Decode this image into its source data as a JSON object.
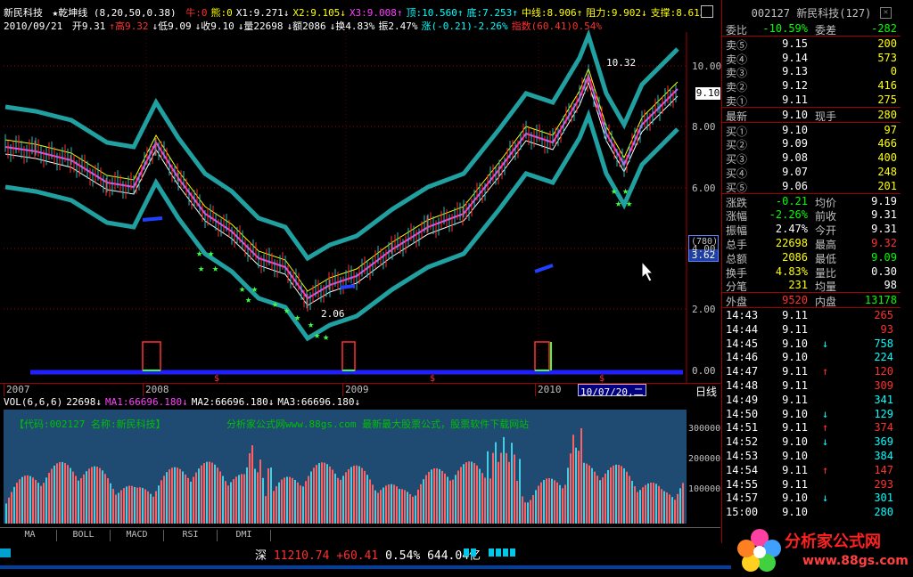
{
  "indicator_bar": {
    "name": "新民科技",
    "formula": "★乾坤线",
    "params": "(8,20,50,0.38)",
    "items": [
      {
        "text": "牛:0",
        "color": "#ff3030"
      },
      {
        "text": "熊:0",
        "color": "#ffff00"
      },
      {
        "text": "X1:9.271↓",
        "color": "#ffffff"
      },
      {
        "text": "X2:9.105↓",
        "color": "#ffff00"
      },
      {
        "text": "X3:9.008↑",
        "color": "#ff40ff"
      },
      {
        "text": "顶:10.560↑",
        "color": "#00ffff"
      },
      {
        "text": "底:7.253↑",
        "color": "#00ffff"
      },
      {
        "text": "中线:8.906↑",
        "color": "#ffff00"
      },
      {
        "text": "阻力:9.902↓",
        "color": "#ffff00"
      },
      {
        "text": "支撑:8.613↓",
        "color": "#ffff00"
      }
    ]
  },
  "ohlc_bar": {
    "date": "2010/09/21",
    "items": [
      {
        "text": "开9.31",
        "color": "#ffffff"
      },
      {
        "text": "↑高9.32",
        "color": "#ff3030"
      },
      {
        "text": "↓低9.09",
        "color": "#ffffff"
      },
      {
        "text": "↓收9.10",
        "color": "#ffffff"
      },
      {
        "text": "↓量22698",
        "color": "#ffffff"
      },
      {
        "text": "↓额2086",
        "color": "#ffffff"
      },
      {
        "text": "↓换4.83%",
        "color": "#ffffff"
      },
      {
        "text": "振2.47%",
        "color": "#ffffff"
      },
      {
        "text": "涨(-0.21)-2.26%",
        "color": "#00ffff"
      },
      {
        "text": "指数(60.41)0.54%",
        "color": "#ff3030"
      }
    ]
  },
  "price_axis": [
    "10.00",
    "8.00",
    "6.00",
    "4.00",
    "2.00",
    "0.00"
  ],
  "price_tag": "9.10",
  "pr_box": {
    "top": "(780)",
    "value": "3.62"
  },
  "chart_annotations": {
    "high": "10.32",
    "low": "2.06"
  },
  "date_axis": {
    "ticks": [
      "2007",
      "2008",
      "2009",
      "2010"
    ],
    "cursor": "10/07/20,二",
    "period": "日线"
  },
  "volume_head": {
    "items": [
      {
        "text": "VOL(6,6,6)",
        "color": "#ffffff"
      },
      {
        "text": "22698↓",
        "color": "#ffffff"
      },
      {
        "text": "MA1:66696.180↓",
        "color": "#ff40ff"
      },
      {
        "text": "MA2:66696.180↓",
        "color": "#ffffff"
      },
      {
        "text": "MA3:66696.180↓",
        "color": "#ffffff"
      }
    ],
    "banner": "【代码:002127 名称:新民科技】",
    "site": "分析家公式网www.88gs.com 最新最大股票公式，股票软件下载网站",
    "axis": [
      "300000",
      "200000",
      "100000"
    ]
  },
  "tabs": [
    "MA",
    "BOLL",
    "MACD",
    "RSI",
    "DMI"
  ],
  "status_bar": {
    "market": "深",
    "index": "11210.74",
    "change": "+60.41",
    "pct": "0.54%",
    "amount": "644.04亿"
  },
  "quote_panel": {
    "code": "002127",
    "name": "新民科技",
    "extra": "(127)",
    "weibi_label": "委比",
    "weibi_value": "-10.59%",
    "weicha_label": "委差",
    "weicha_value": "-282",
    "sell": [
      {
        "label": "卖⑤",
        "price": "9.15",
        "vol": "200"
      },
      {
        "label": "卖④",
        "price": "9.14",
        "vol": "573"
      },
      {
        "label": "卖③",
        "price": "9.13",
        "vol": "0"
      },
      {
        "label": "卖②",
        "price": "9.12",
        "vol": "416"
      },
      {
        "label": "卖①",
        "price": "9.11",
        "vol": "275"
      }
    ],
    "latest": {
      "label": "最新",
      "price": "9.10",
      "label2": "现手",
      "vol": "280"
    },
    "buy": [
      {
        "label": "买①",
        "price": "9.10",
        "vol": "97"
      },
      {
        "label": "买②",
        "price": "9.09",
        "vol": "466"
      },
      {
        "label": "买③",
        "price": "9.08",
        "vol": "400"
      },
      {
        "label": "买④",
        "price": "9.07",
        "vol": "248"
      },
      {
        "label": "买⑤",
        "price": "9.06",
        "vol": "201"
      }
    ],
    "stats": [
      {
        "l1": "涨跌",
        "v1": "-0.21",
        "c1": "#00ff00",
        "l2": "均价",
        "v2": "9.19",
        "c2": "#ffffff"
      },
      {
        "l1": "涨幅",
        "v1": "-2.26%",
        "c1": "#00ff00",
        "l2": "前收",
        "v2": "9.31",
        "c2": "#ffffff"
      },
      {
        "l1": "振幅",
        "v1": "2.47%",
        "c1": "#ffffff",
        "l2": "今开",
        "v2": "9.31",
        "c2": "#ffffff"
      },
      {
        "l1": "总手",
        "v1": "22698",
        "c1": "#ffff00",
        "l2": "最高",
        "v2": "9.32",
        "c2": "#ff3030"
      },
      {
        "l1": "总额",
        "v1": "2086",
        "c1": "#ffff00",
        "l2": "最低",
        "v2": "9.09",
        "c2": "#00ff00"
      },
      {
        "l1": "换手",
        "v1": "4.83%",
        "c1": "#ffff00",
        "l2": "量比",
        "v2": "0.30",
        "c2": "#ffffff"
      },
      {
        "l1": "分笔",
        "v1": "231",
        "c1": "#ffff00",
        "l2": "均量",
        "v2": "98",
        "c2": "#ffffff"
      }
    ],
    "outer": {
      "l1": "外盘",
      "v1": "9520",
      "l2": "内盘",
      "v2": "13178"
    },
    "ticks": [
      {
        "time": "14:43",
        "price": "9.11",
        "arrow": "",
        "vol": "265",
        "vcolor": "#ff3030"
      },
      {
        "time": "14:44",
        "price": "9.11",
        "arrow": "",
        "vol": "93",
        "vcolor": "#ff3030"
      },
      {
        "time": "14:45",
        "price": "9.10",
        "arrow": "↓",
        "vol": "758",
        "vcolor": "#00ffff"
      },
      {
        "time": "14:46",
        "price": "9.10",
        "arrow": "",
        "vol": "224",
        "vcolor": "#00ffff"
      },
      {
        "time": "14:47",
        "price": "9.11",
        "arrow": "↑",
        "vol": "120",
        "vcolor": "#ff3030"
      },
      {
        "time": "14:48",
        "price": "9.11",
        "arrow": "",
        "vol": "309",
        "vcolor": "#ff3030"
      },
      {
        "time": "14:49",
        "price": "9.11",
        "arrow": "",
        "vol": "341",
        "vcolor": "#00ffff"
      },
      {
        "time": "14:50",
        "price": "9.10",
        "arrow": "↓",
        "vol": "129",
        "vcolor": "#00ffff"
      },
      {
        "time": "14:51",
        "price": "9.11",
        "arrow": "↑",
        "vol": "374",
        "vcolor": "#ff3030"
      },
      {
        "time": "14:52",
        "price": "9.10",
        "arrow": "↓",
        "vol": "369",
        "vcolor": "#00ffff"
      },
      {
        "time": "14:53",
        "price": "9.10",
        "arrow": "",
        "vol": "384",
        "vcolor": "#00ffff"
      },
      {
        "time": "14:54",
        "price": "9.11",
        "arrow": "↑",
        "vol": "147",
        "vcolor": "#ff3030"
      },
      {
        "time": "14:55",
        "price": "9.11",
        "arrow": "",
        "vol": "293",
        "vcolor": "#ff3030"
      },
      {
        "time": "14:57",
        "price": "9.10",
        "arrow": "↓",
        "vol": "301",
        "vcolor": "#00ffff"
      },
      {
        "time": "15:00",
        "price": "9.10",
        "arrow": "",
        "vol": "280",
        "vcolor": "#00ffff"
      }
    ]
  },
  "logo": {
    "text": "分析家公式网",
    "url": "www.88gs.com"
  }
}
